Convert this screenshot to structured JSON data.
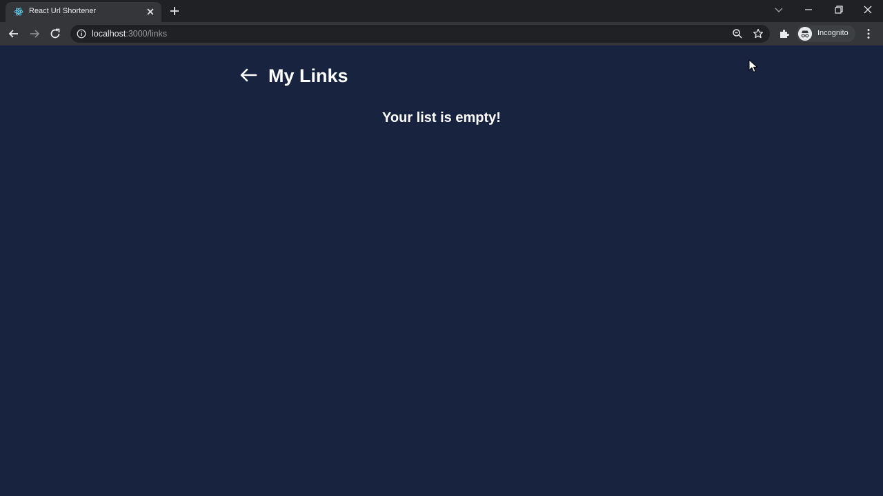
{
  "browser": {
    "tab": {
      "title": "React Url Shortener"
    },
    "address": {
      "host": "localhost",
      "path": ":3000/links"
    },
    "profile": {
      "label": "Incognito"
    }
  },
  "page": {
    "title": "My Links",
    "empty_message": "Your list is empty!"
  },
  "icons": {
    "favicon": "react-icon",
    "back": "arrow-left-icon",
    "zoom": "zoom-icon",
    "bookmark": "star-icon",
    "extensions": "puzzle-icon",
    "menu": "kebab-menu-icon"
  },
  "colors": {
    "background": "#17233f",
    "text": "#ffffff",
    "chrome_dark": "#202124",
    "chrome_toolbar": "#35363a"
  }
}
